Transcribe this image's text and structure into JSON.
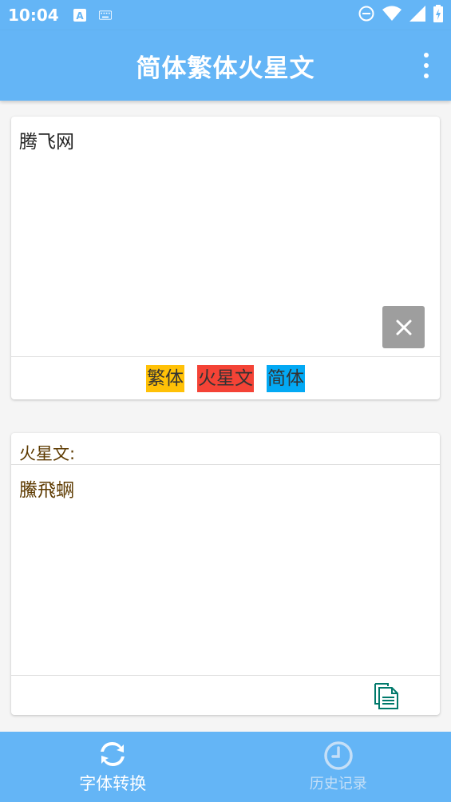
{
  "status_bar": {
    "time": "10:04",
    "icons": [
      "a-notification-icon",
      "keyboard-icon",
      "do-not-disturb-icon",
      "wifi-icon",
      "signal-icon",
      "battery-icon"
    ]
  },
  "app_bar": {
    "title": "简体繁体火星文",
    "menu_icon": "more-vert-icon"
  },
  "input": {
    "value": "腾飞网",
    "clear_icon": "close-icon"
  },
  "modes": {
    "traditional": "繁体",
    "martian": "火星文",
    "simplified": "简体"
  },
  "output": {
    "label": "火星文:",
    "text": "鰧飛蛧",
    "copy_icon": "copy-icon"
  },
  "bottom_nav": {
    "convert_label": "字体转换",
    "history_label": "历史记录"
  },
  "colors": {
    "primary": "#64b5f6",
    "traditional": "#ffc107",
    "martian": "#f44336",
    "simplified": "#03a9f4",
    "output_text": "#5d3a00",
    "clear_button": "#9e9e9e"
  }
}
